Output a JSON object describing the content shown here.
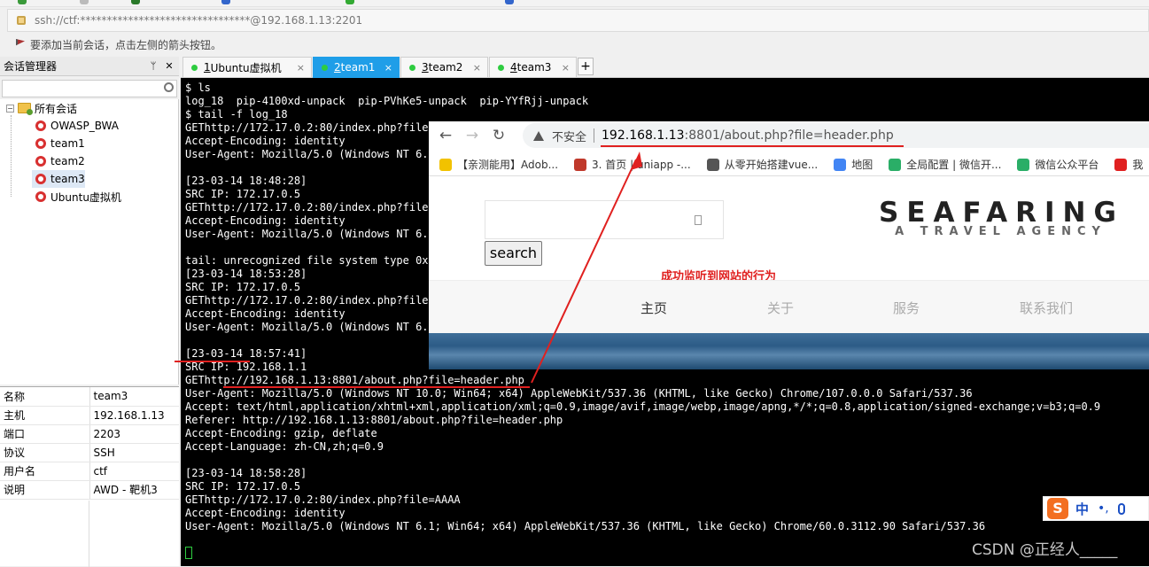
{
  "address_bar": {
    "text": "ssh://ctf:********************************@192.168.1.13:2201"
  },
  "hint_bar": {
    "text": "要添加当前会话，点击左侧的箭头按钮。"
  },
  "session_manager": {
    "title": "会话管理器",
    "pin_label": "ᛘ",
    "close_label": "✕",
    "tree": {
      "root": "所有会话",
      "items": [
        "OWASP_BWA",
        "team1",
        "team2",
        "team3",
        "Ubuntu虚拟机"
      ],
      "selected": "team3"
    }
  },
  "properties": [
    {
      "key": "名称",
      "value": "team3"
    },
    {
      "key": "主机",
      "value": "192.168.1.13"
    },
    {
      "key": "端口",
      "value": "2203"
    },
    {
      "key": "协议",
      "value": "SSH"
    },
    {
      "key": "用户名",
      "value": "ctf"
    },
    {
      "key": "说明",
      "value": "AWD - 靶机3"
    }
  ],
  "tabs": [
    {
      "num": "1",
      "label": " Ubuntu虚拟机",
      "active": false
    },
    {
      "num": "2",
      "label": " team1",
      "active": true
    },
    {
      "num": "3",
      "label": " team2",
      "active": false
    },
    {
      "num": "4",
      "label": " team3",
      "active": false
    }
  ],
  "tab_close": "×",
  "new_tab": "+",
  "terminal": {
    "lines": [
      "$ ls",
      "log_18  pip-4100xd-unpack  pip-PVhKe5-unpack  pip-YYfRjj-unpack",
      "$ tail -f log_18",
      "GEThttp://172.17.0.2:80/index.php?file=",
      "Accept-Encoding: identity",
      "User-Agent: Mozilla/5.0 (Windows NT 6.1",
      "",
      "[23-03-14 18:48:28]",
      "SRC IP: 172.17.0.5",
      "GEThttp://172.17.0.2:80/index.php?file=",
      "Accept-Encoding: identity",
      "User-Agent: Mozilla/5.0 (Windows NT 6.1",
      "",
      "tail: unrecognized file system type 0x7",
      "[23-03-14 18:53:28]",
      "SRC IP: 172.17.0.5",
      "GEThttp://172.17.0.2:80/index.php?file=",
      "Accept-Encoding: identity",
      "User-Agent: Mozilla/5.0 (Windows NT 6.1",
      "",
      "[23-03-14 18:57:41]",
      "SRC IP: 192.168.1.1",
      "GEThttp://192.168.1.13:8801/about.php?file=header.php",
      "User-Agent: Mozilla/5.0 (Windows NT 10.0; Win64; x64) AppleWebKit/537.36 (KHTML, like Gecko) Chrome/107.0.0.0 Safari/537.36",
      "Accept: text/html,application/xhtml+xml,application/xml;q=0.9,image/avif,image/webp,image/apng,*/*;q=0.8,application/signed-exchange;v=b3;q=0.9",
      "Referer: http://192.168.1.13:8801/about.php?file=header.php",
      "Accept-Encoding: gzip, deflate",
      "Accept-Language: zh-CN,zh;q=0.9",
      "",
      "[23-03-14 18:58:28]",
      "SRC IP: 172.17.0.5",
      "GEThttp://172.17.0.2:80/index.php?file=AAAA",
      "Accept-Encoding: identity",
      "User-Agent: Mozilla/5.0 (Windows NT 6.1; Win64; x64) AppleWebKit/537.36 (KHTML, like Gecko) Chrome/60.0.3112.90 Safari/537.36"
    ]
  },
  "browser": {
    "back": "←",
    "forward": "→",
    "reload": "↻",
    "not_secure": "不安全",
    "url_host": "192.168.1.13",
    "url_rest": ":8801/about.php?file=header.php",
    "bookmarks": [
      {
        "label": "【亲测能用】Adob...",
        "color": "#f2c200"
      },
      {
        "label": "3. 首页 | uniapp -...",
        "color": "#c0392b"
      },
      {
        "label": "从零开始搭建vue...",
        "color": "#555555"
      },
      {
        "label": "地图",
        "color": "#4285f4"
      },
      {
        "label": "全局配置 | 微信开...",
        "color": "#2aae67"
      },
      {
        "label": "微信公众平台",
        "color": "#2aae67"
      },
      {
        "label": "我",
        "color": "#e02020"
      }
    ],
    "page": {
      "search_button": "search",
      "logo_main": "SEAFARING",
      "logo_sub": "A TRAVEL AGENCY",
      "menu": [
        "主页",
        "关于",
        "服务",
        "联系我们"
      ],
      "menu_active": "主页"
    }
  },
  "annotation": {
    "text": "成功监听到网站的行为",
    "color": "#e0201f"
  },
  "ime": {
    "logo": "S",
    "lang": "中",
    "punct": "•,"
  },
  "watermark": "CSDN @正经人_____"
}
